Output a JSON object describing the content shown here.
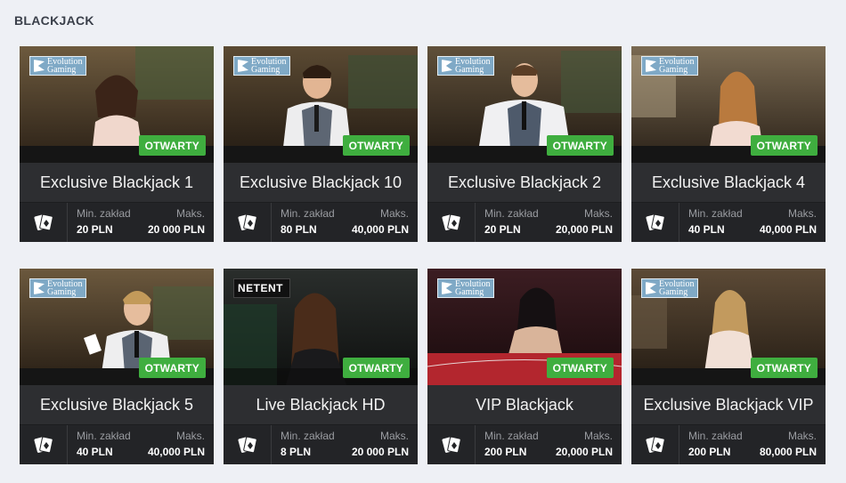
{
  "section_title": "BLACKJACK",
  "colors": {
    "status_green": "#3fae3f",
    "card_bg": "#2b2c2f",
    "page_bg": "#eef0f5"
  },
  "tables": [
    {
      "name": "Exclusive Blackjack 1",
      "provider": "Evolution Gaming",
      "provider_line1": "Evolution",
      "provider_line2": "Gaming",
      "status": "OTWARTY",
      "min_label": "Min. zakład",
      "max_label": "Maks.",
      "min": "20 PLN",
      "max": "20 000 PLN",
      "icon": "cards-icon"
    },
    {
      "name": "Exclusive Blackjack 10",
      "provider": "Evolution Gaming",
      "provider_line1": "Evolution",
      "provider_line2": "Gaming",
      "status": "OTWARTY",
      "min_label": "Min. zakład",
      "max_label": "Maks.",
      "min": "80 PLN",
      "max": "40,000 PLN",
      "icon": "cards-icon"
    },
    {
      "name": "Exclusive Blackjack 2",
      "provider": "Evolution Gaming",
      "provider_line1": "Evolution",
      "provider_line2": "Gaming",
      "status": "OTWARTY",
      "min_label": "Min. zakład",
      "max_label": "Maks.",
      "min": "20 PLN",
      "max": "20,000 PLN",
      "icon": "cards-icon"
    },
    {
      "name": "Exclusive Blackjack 4",
      "provider": "Evolution Gaming",
      "provider_line1": "Evolution",
      "provider_line2": "Gaming",
      "status": "OTWARTY",
      "min_label": "Min. zakład",
      "max_label": "Maks.",
      "min": "40 PLN",
      "max": "40,000 PLN",
      "icon": "cards-icon"
    },
    {
      "name": "Exclusive Blackjack 5",
      "provider": "Evolution Gaming",
      "provider_line1": "Evolution",
      "provider_line2": "Gaming",
      "status": "OTWARTY",
      "min_label": "Min. zakład",
      "max_label": "Maks.",
      "min": "40 PLN",
      "max": "40,000 PLN",
      "icon": "cards-icon"
    },
    {
      "name": "Live Blackjack HD",
      "provider": "NETENT",
      "provider_line1": "NETENT",
      "provider_line2": "",
      "status": "OTWARTY",
      "min_label": "Min. zakład",
      "max_label": "Maks.",
      "min": "8 PLN",
      "max": "20 000 PLN",
      "icon": "cards-icon"
    },
    {
      "name": "VIP Blackjack",
      "provider": "Evolution Gaming",
      "provider_line1": "Evolution",
      "provider_line2": "Gaming",
      "status": "OTWARTY",
      "min_label": "Min. zakład",
      "max_label": "Maks.",
      "min": "200 PLN",
      "max": "20,000 PLN",
      "icon": "cards-icon"
    },
    {
      "name": "Exclusive Blackjack VIP",
      "provider": "Evolution Gaming",
      "provider_line1": "Evolution",
      "provider_line2": "Gaming",
      "status": "OTWARTY",
      "min_label": "Min. zakład",
      "max_label": "Maks.",
      "min": "200 PLN",
      "max": "80,000 PLN",
      "icon": "cards-icon"
    }
  ]
}
